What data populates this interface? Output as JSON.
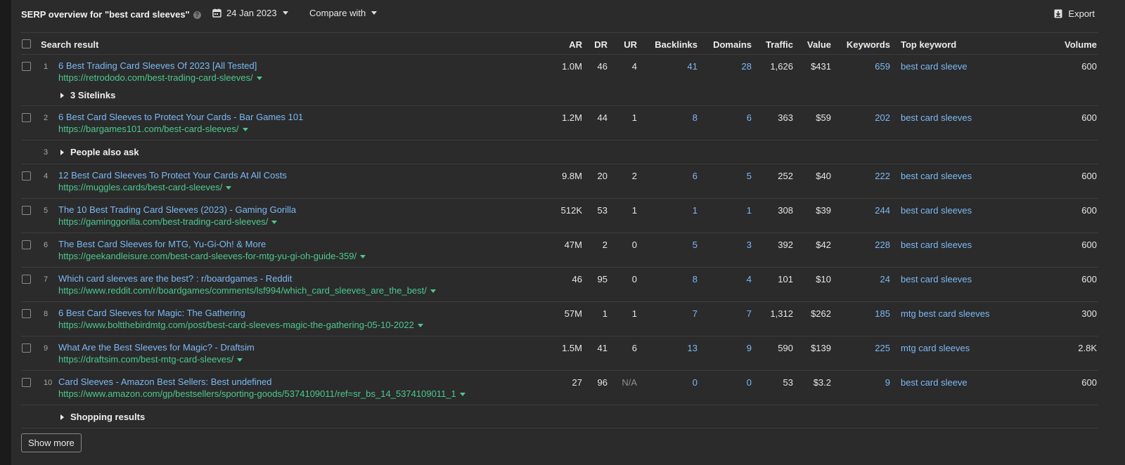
{
  "header": {
    "title": "SERP overview for \"best card sleeves\"",
    "help_icon": "?",
    "date": "24 Jan 2023",
    "compare": "Compare with",
    "export": "Export"
  },
  "columns": {
    "search_result": "Search result",
    "ar": "AR",
    "dr": "DR",
    "ur": "UR",
    "backlinks": "Backlinks",
    "domains": "Domains",
    "traffic": "Traffic",
    "value": "Value",
    "keywords": "Keywords",
    "top_keyword": "Top keyword",
    "volume": "Volume"
  },
  "rows": [
    {
      "num": "1",
      "title": "6 Best Trading Card Sleeves Of 2023 [All Tested]",
      "url": "https://retrododo.com/best-trading-card-sleeves/",
      "ar": "1.0M",
      "dr": "46",
      "ur": "4",
      "backlinks": "41",
      "domains": "28",
      "traffic": "1,626",
      "value": "$431",
      "keywords": "659",
      "top_keyword": "best card sleeve",
      "volume": "600"
    },
    {
      "num": "2",
      "title": "6 Best Card Sleeves to Protect Your Cards - Bar Games 101",
      "url": "https://bargames101.com/best-card-sleeves/",
      "ar": "1.2M",
      "dr": "44",
      "ur": "1",
      "backlinks": "8",
      "domains": "6",
      "traffic": "363",
      "value": "$59",
      "keywords": "202",
      "top_keyword": "best card sleeves",
      "volume": "600"
    },
    {
      "num": "4",
      "title": "12 Best Card Sleeves To Protect Your Cards At All Costs",
      "url": "https://muggles.cards/best-card-sleeves/",
      "ar": "9.8M",
      "dr": "20",
      "ur": "2",
      "backlinks": "6",
      "domains": "5",
      "traffic": "252",
      "value": "$40",
      "keywords": "222",
      "top_keyword": "best card sleeves",
      "volume": "600"
    },
    {
      "num": "5",
      "title": "The 10 Best Trading Card Sleeves (2023) - Gaming Gorilla",
      "url": "https://gaminggorilla.com/best-trading-card-sleeves/",
      "ar": "512K",
      "dr": "53",
      "ur": "1",
      "backlinks": "1",
      "domains": "1",
      "traffic": "308",
      "value": "$39",
      "keywords": "244",
      "top_keyword": "best card sleeves",
      "volume": "600"
    },
    {
      "num": "6",
      "title": "The Best Card Sleeves for MTG, Yu-Gi-Oh! & More",
      "url": "https://geekandleisure.com/best-card-sleeves-for-mtg-yu-gi-oh-guide-359/",
      "ar": "47M",
      "dr": "2",
      "ur": "0",
      "backlinks": "5",
      "domains": "3",
      "traffic": "392",
      "value": "$42",
      "keywords": "228",
      "top_keyword": "best card sleeves",
      "volume": "600"
    },
    {
      "num": "7",
      "title": "Which card sleeves are the best? : r/boardgames - Reddit",
      "url": "https://www.reddit.com/r/boardgames/comments/lsf994/which_card_sleeves_are_the_best/",
      "ar": "46",
      "dr": "95",
      "ur": "0",
      "backlinks": "8",
      "domains": "4",
      "traffic": "101",
      "value": "$10",
      "keywords": "24",
      "top_keyword": "best card sleeves",
      "volume": "600"
    },
    {
      "num": "8",
      "title": "6 Best Card Sleeves for Magic: The Gathering",
      "url": "https://www.boltthebirdmtg.com/post/best-card-sleeves-magic-the-gathering-05-10-2022",
      "ar": "57M",
      "dr": "1",
      "ur": "1",
      "backlinks": "7",
      "domains": "7",
      "traffic": "1,312",
      "value": "$262",
      "keywords": "185",
      "top_keyword": "mtg best card sleeves",
      "volume": "300"
    },
    {
      "num": "9",
      "title": "What Are the Best Sleeves for Magic? - Draftsim",
      "url": "https://draftsim.com/best-mtg-card-sleeves/",
      "ar": "1.5M",
      "dr": "41",
      "ur": "6",
      "backlinks": "13",
      "domains": "9",
      "traffic": "590",
      "value": "$139",
      "keywords": "225",
      "top_keyword": "mtg card sleeves",
      "volume": "2.8K"
    },
    {
      "num": "10",
      "title": "Card Sleeves - Amazon Best Sellers: Best undefined",
      "url": "https://www.amazon.com/gp/bestsellers/sporting-goods/5374109011/ref=sr_bs_14_5374109011_1",
      "ar": "27",
      "dr": "96",
      "ur": "N/A",
      "backlinks": "0",
      "domains": "0",
      "traffic": "53",
      "value": "$3.2",
      "keywords": "9",
      "top_keyword": "best card sleeve",
      "volume": "600"
    }
  ],
  "sitelinks": "3 Sitelinks",
  "people_also_ask": {
    "num": "3",
    "label": "People also ask"
  },
  "shopping": "Shopping results",
  "show_more": "Show more",
  "colors": {
    "link": "#7cb9f3",
    "url": "#4cc98c",
    "bg": "#2b2b2c"
  }
}
